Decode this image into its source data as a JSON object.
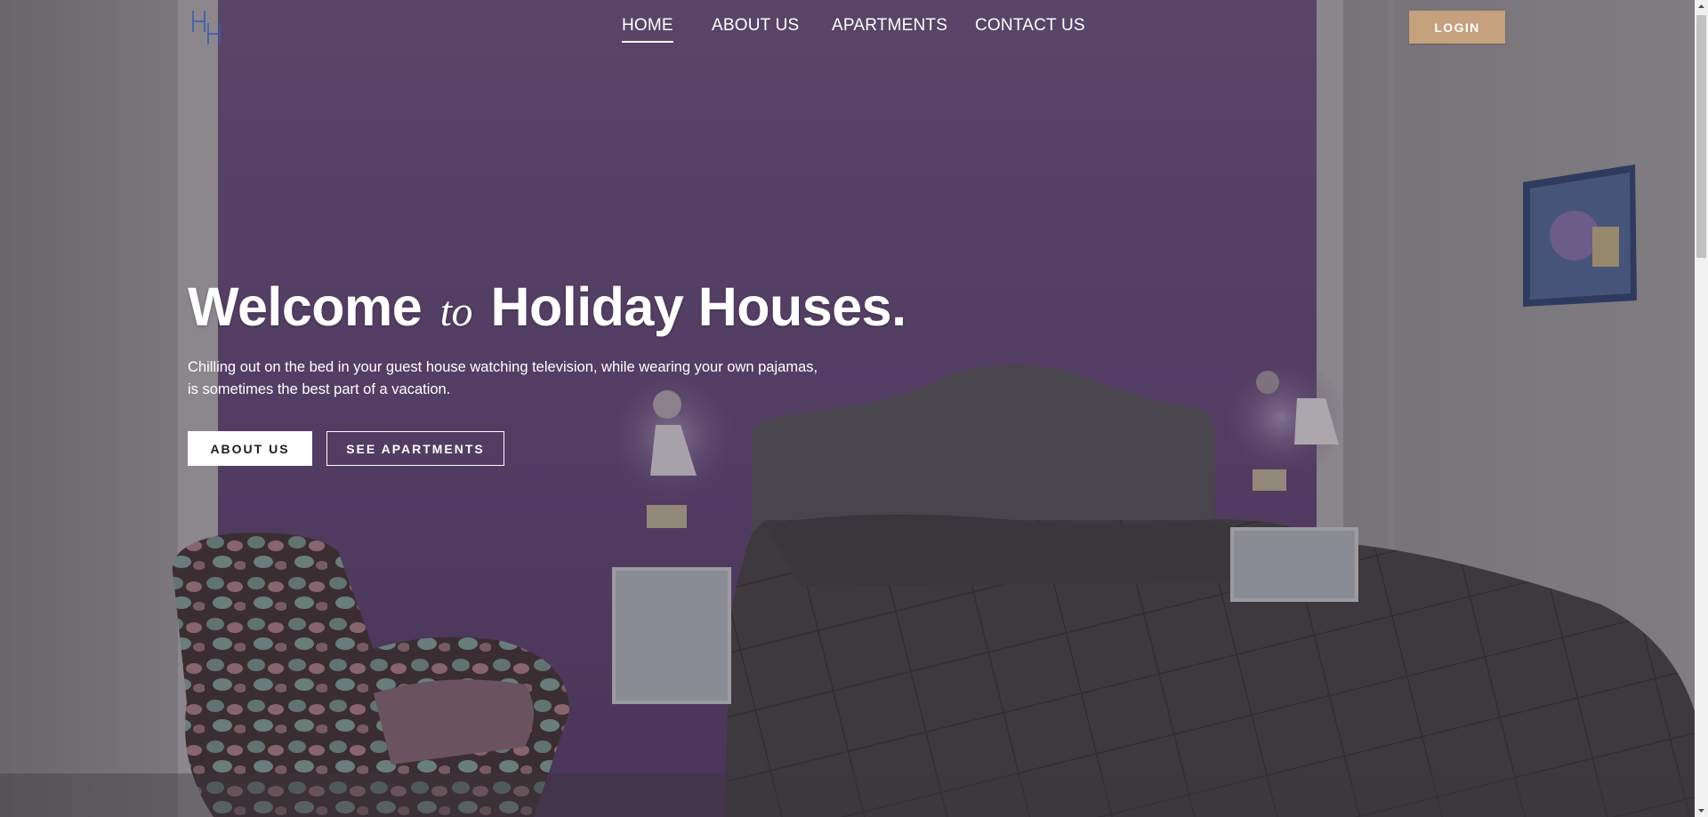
{
  "brand": {
    "logo_icon": "hh-monogram-icon",
    "logo_color": "#3a5bb0"
  },
  "nav": {
    "items": [
      {
        "label": "HOME",
        "active": true
      },
      {
        "label": "ABOUT US",
        "active": false
      },
      {
        "label": "APARTMENTS",
        "active": false
      },
      {
        "label": "CONTACT US",
        "active": false
      }
    ],
    "login_label": "LOGIN",
    "login_color": "#c5a17e"
  },
  "hero": {
    "title_part1": "Welcome",
    "title_connector": "to",
    "title_part2": "Holiday Houses.",
    "subtitle_line1": "Chilling out on the bed in your guest house watching television, while wearing your own pajamas,",
    "subtitle_line2": "is sometimes the best part of a vacation.",
    "primary_button": "ABOUT US",
    "secondary_button": "SEE APARTMENTS",
    "background_image": "bedroom-photo",
    "accent_wall_color": "#7b5a98"
  },
  "scrollbar": {
    "position": 0.0
  }
}
